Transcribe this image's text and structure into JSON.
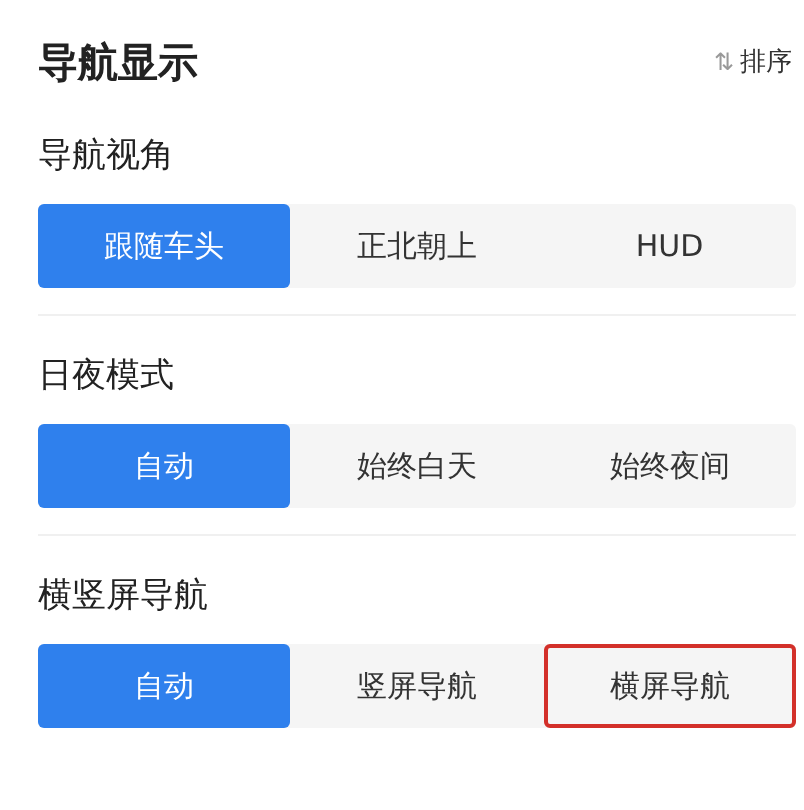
{
  "header": {
    "title": "导航显示",
    "sort_icon": "⇅",
    "sort_label": "排序"
  },
  "sections": [
    {
      "title": "导航视角",
      "options": [
        {
          "label": "跟随车头",
          "selected": true,
          "highlighted": false
        },
        {
          "label": "正北朝上",
          "selected": false,
          "highlighted": false
        },
        {
          "label": "HUD",
          "selected": false,
          "highlighted": false
        }
      ]
    },
    {
      "title": "日夜模式",
      "options": [
        {
          "label": "自动",
          "selected": true,
          "highlighted": false
        },
        {
          "label": "始终白天",
          "selected": false,
          "highlighted": false
        },
        {
          "label": "始终夜间",
          "selected": false,
          "highlighted": false
        }
      ]
    },
    {
      "title": "横竖屏导航",
      "options": [
        {
          "label": "自动",
          "selected": true,
          "highlighted": false
        },
        {
          "label": "竖屏导航",
          "selected": false,
          "highlighted": false
        },
        {
          "label": "横屏导航",
          "selected": false,
          "highlighted": true
        }
      ]
    }
  ]
}
